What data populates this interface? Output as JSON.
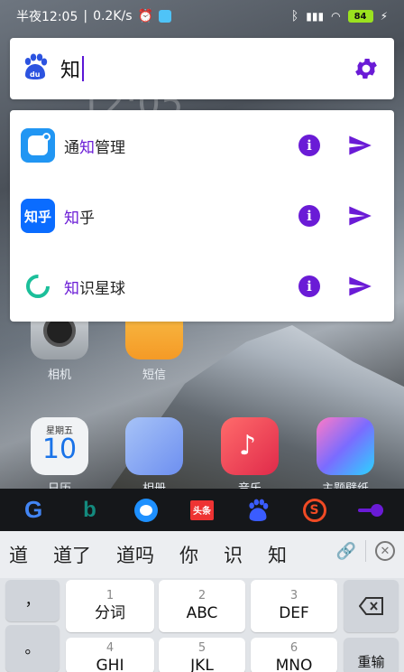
{
  "status_bar": {
    "time_text": "半夜12:05",
    "speed": "0.2K/s",
    "battery": "84"
  },
  "search": {
    "query": "知",
    "settings_icon": "gear-icon",
    "engine_icon": "baidu-paw-icon"
  },
  "suggestions": [
    {
      "prefix": "通",
      "highlight": "知",
      "suffix": "管理",
      "icon": "notification-manager-icon"
    },
    {
      "prefix": "",
      "highlight": "知",
      "suffix": "乎",
      "icon": "zhihu-icon",
      "icon_text": "知乎"
    },
    {
      "prefix": "",
      "highlight": "知",
      "suffix": "识星球",
      "icon": "knowledge-planet-icon"
    }
  ],
  "home_screen": {
    "clock_ghost": "12:05",
    "apps": [
      {
        "name": "相机"
      },
      {
        "name": "短信"
      },
      {
        "name": "日历",
        "day": "星期五",
        "date": "10"
      },
      {
        "name": "相册"
      },
      {
        "name": "音乐"
      },
      {
        "name": "主题壁纸"
      }
    ]
  },
  "engines": [
    {
      "name": "Google",
      "icon": "google-icon"
    },
    {
      "name": "Bing",
      "icon": "bing-icon"
    },
    {
      "name": "Bird",
      "icon": "bird-icon"
    },
    {
      "name": "头条",
      "icon": "toutiao-icon"
    },
    {
      "name": "Baidu",
      "icon": "baidu-icon"
    },
    {
      "name": "Sogou",
      "icon": "sogou-icon"
    },
    {
      "name": "Toggle",
      "icon": "toggle-icon"
    }
  ],
  "candidates": [
    "道",
    "道了",
    "道吗",
    "你",
    "识",
    "知"
  ],
  "keyboard": {
    "punct_1": "，",
    "punct_2": "。",
    "keys": [
      {
        "num": "1",
        "label": "分词"
      },
      {
        "num": "2",
        "label": "ABC"
      },
      {
        "num": "3",
        "label": "DEF"
      },
      {
        "num": "4",
        "label": "GHI"
      },
      {
        "num": "5",
        "label": "JKL"
      },
      {
        "num": "6",
        "label": "MNO"
      }
    ],
    "retype": "重输"
  },
  "colors": {
    "accent": "#6a1bd6",
    "engine_bar": "#15171a",
    "keyboard_bg": "#e1e4e8"
  }
}
